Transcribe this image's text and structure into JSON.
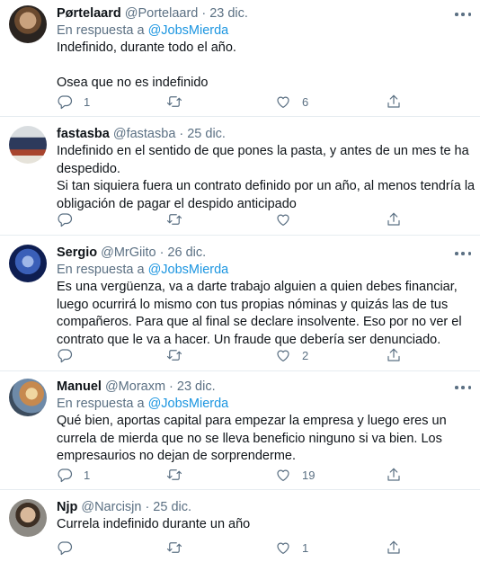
{
  "tweets": [
    {
      "name": "Pørtelaard",
      "handle": "@Portelaard",
      "date": "23 dic.",
      "reply_prefix": "En respuesta a",
      "reply_to": "@JobsMierda",
      "lines": [
        "Indefinido, durante todo el año.",
        "",
        "Osea que no es indefinido"
      ],
      "replies": "1",
      "retweets": "",
      "likes": "6"
    },
    {
      "name": "fastasba",
      "handle": "@fastasba",
      "date": "25 dic.",
      "reply_prefix": "",
      "reply_to": "",
      "lines": [
        "Indefinido en el sentido de que pones la pasta, y antes de un mes te ha",
        "despedido.",
        "Si tan siquiera fuera un contrato definido por un año, al menos tendría la",
        "obligación de pagar el despido anticipado"
      ],
      "replies": "",
      "retweets": "",
      "likes": ""
    },
    {
      "name": "Sergio",
      "handle": "@MrGiito",
      "date": "26 dic.",
      "reply_prefix": "En respuesta a",
      "reply_to": "@JobsMierda",
      "lines": [
        "Es una vergüenza, va a darte trabajo alguien a quien debes financiar,",
        "luego ocurrirá lo mismo con tus propias nóminas y quizás las de tus",
        "compañeros. Para que al final se declare insolvente. Eso por no ver el",
        "contrato que le va a hacer. Un fraude que debería ser denunciado."
      ],
      "replies": "",
      "retweets": "",
      "likes": "2"
    },
    {
      "name": "Manuel",
      "handle": "@Moraxm",
      "date": "23 dic.",
      "reply_prefix": "En respuesta a",
      "reply_to": "@JobsMierda",
      "lines": [
        "Qué bien, aportas capital para empezar la empresa y luego eres un",
        "currela de mierda que no se lleva beneficio ninguno si va bien. Los",
        "empresaurios no dejan de sorprenderme."
      ],
      "replies": "1",
      "retweets": "",
      "likes": "19"
    },
    {
      "name": "Njp",
      "handle": "@Narcisjn",
      "date": "25 dic.",
      "reply_prefix": "",
      "reply_to": "",
      "lines": [
        "Currela indefinido durante un año"
      ],
      "replies": "",
      "retweets": "",
      "likes": "1"
    }
  ],
  "icons": {
    "reply": "reply-icon",
    "retweet": "retweet-icon",
    "like": "like-icon",
    "share": "share-icon",
    "more": "more-icon"
  },
  "colors": {
    "text": "#0f1419",
    "secondary": "#5b7083",
    "link": "#1b95e0",
    "divider": "#e6ecf0"
  }
}
